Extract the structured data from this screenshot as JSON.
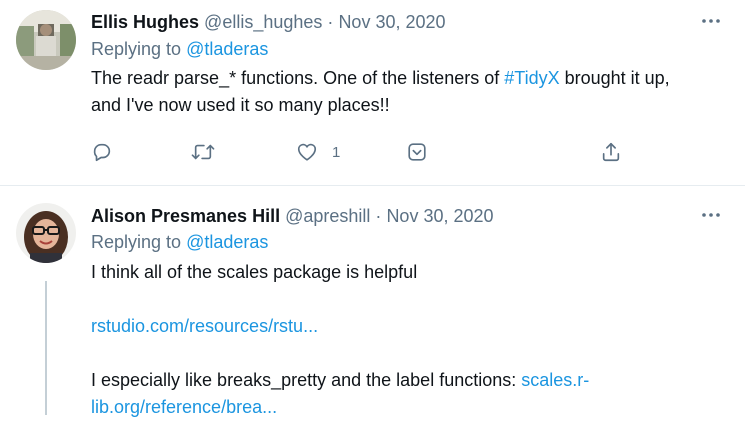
{
  "tweets": [
    {
      "name": "Ellis Hughes",
      "handle": "@ellis_hughes",
      "separator": "·",
      "date": "Nov 30, 2020",
      "replying_prefix": "Replying to",
      "replying_to": "@tladeras",
      "text_line1_a": "The readr parse_* functions. One of the listeners of ",
      "hashtag": "#TidyX",
      "text_line1_b": " brought it up,",
      "text_line2": "and I've now used it so many places!!",
      "like_count": "1",
      "icons": [
        "reply-icon",
        "retweet-icon",
        "like-icon",
        "save-icon",
        "share-icon",
        "more-icon"
      ]
    },
    {
      "name": "Alison Presmanes Hill",
      "handle": "@apreshill",
      "separator": "·",
      "date": "Nov 30, 2020",
      "replying_prefix": "Replying to",
      "replying_to": "@tladeras",
      "text_line1": "I think all of the scales package is helpful",
      "link1": "rstudio.com/resources/rstu...",
      "text_line3": "I especially like breaks_pretty and the label functions: ",
      "link2_a": "scales.r-",
      "link2_b": "lib.org/reference/brea...",
      "icons": [
        "more-icon"
      ]
    }
  ],
  "colors": {
    "text": "#0f1419",
    "muted": "#5b7083",
    "link": "#1b95e0",
    "divider": "#e6ecf0"
  }
}
